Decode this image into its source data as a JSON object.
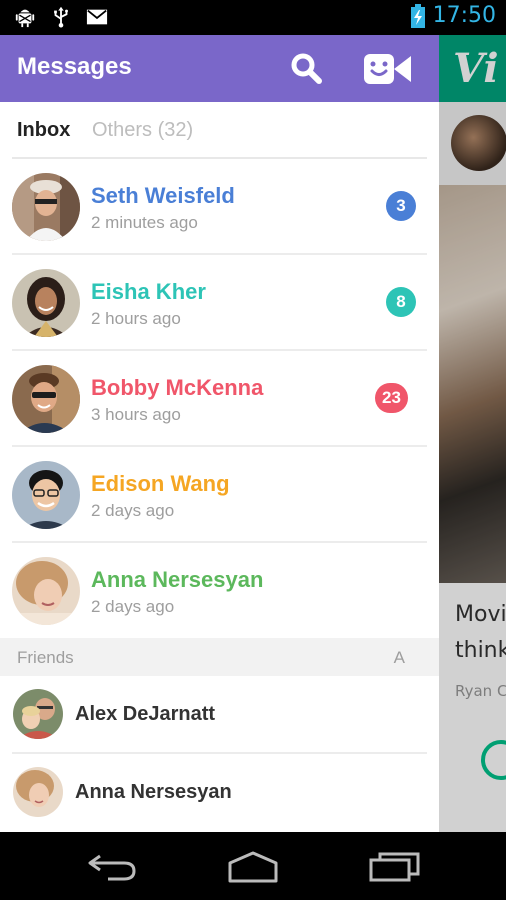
{
  "status_bar": {
    "time": "17:50",
    "left_icons": [
      "android-debug-icon",
      "usb-icon",
      "gmail-icon"
    ],
    "time_color": "#33b5e5"
  },
  "app_bar": {
    "title": "Messages",
    "color": "#7a67c9",
    "actions": [
      "search-icon",
      "video-message-icon"
    ]
  },
  "tabs": [
    {
      "label": "Inbox",
      "active": true
    },
    {
      "label": "Others (32)",
      "active": false
    }
  ],
  "conversations": [
    {
      "name": "Seth Weisfeld",
      "time": "2 minutes ago",
      "unread": "3",
      "color": "#4a7fd6"
    },
    {
      "name": "Eisha Kher",
      "time": "2 hours ago",
      "unread": "8",
      "color": "#2dc4b6"
    },
    {
      "name": "Bobby McKenna",
      "time": "3 hours ago",
      "unread": "23",
      "color": "#f0566a"
    },
    {
      "name": "Edison Wang",
      "time": "2 days ago",
      "unread": "",
      "color": "#f5a623"
    },
    {
      "name": "Anna Nersesyan",
      "time": "2 days ago",
      "unread": "",
      "color": "#5cb85c"
    }
  ],
  "friends": {
    "section_label": "Friends",
    "index_letter": "A",
    "items": [
      {
        "name": "Alex DeJarnatt"
      },
      {
        "name": "Anna Nersesyan"
      }
    ]
  },
  "background_feed": {
    "brand_color": "#00a47e",
    "logo_text": "Vi",
    "post_line_1": "Movi",
    "post_line_2": "think",
    "post_author": "Ryan C"
  },
  "nav_bar": {
    "buttons": [
      "back-icon",
      "home-icon",
      "recents-icon"
    ]
  }
}
